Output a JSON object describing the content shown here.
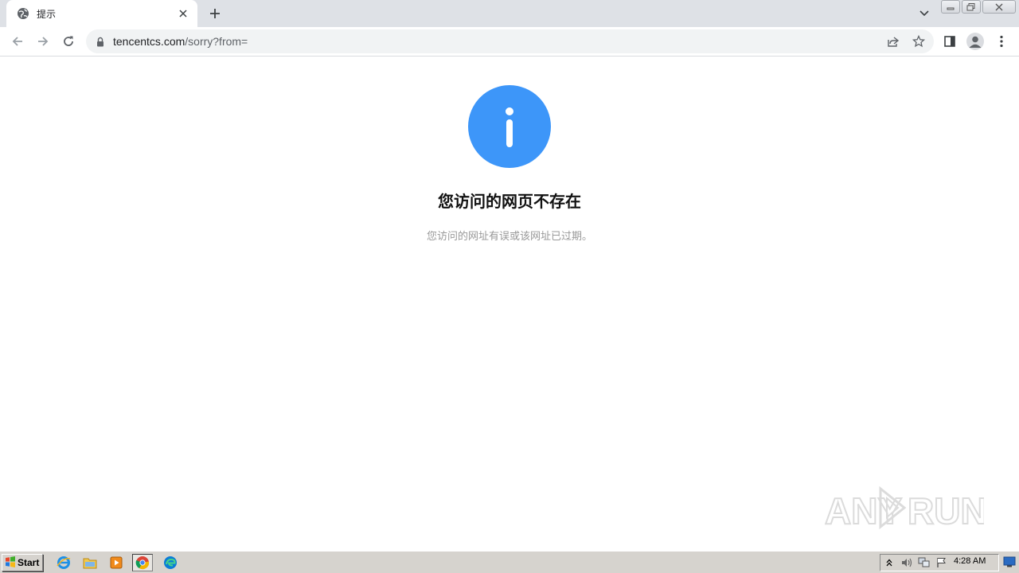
{
  "browser": {
    "tab": {
      "title": "提示",
      "favicon": "globe-icon"
    },
    "url": {
      "host": "tencentcs.com",
      "path": "/sorry?from="
    }
  },
  "page": {
    "icon": "info-icon",
    "accent_color": "#3d96f9",
    "heading": "您访问的网页不存在",
    "message": "您访问的网址有误或该网址已过期。"
  },
  "watermark": {
    "text": "ANY RUN"
  },
  "taskbar": {
    "start_label": "Start",
    "apps": [
      "internet-explorer-icon",
      "file-explorer-icon",
      "media-player-icon",
      "chrome-icon",
      "edge-icon"
    ],
    "clock": "4:28 AM"
  }
}
